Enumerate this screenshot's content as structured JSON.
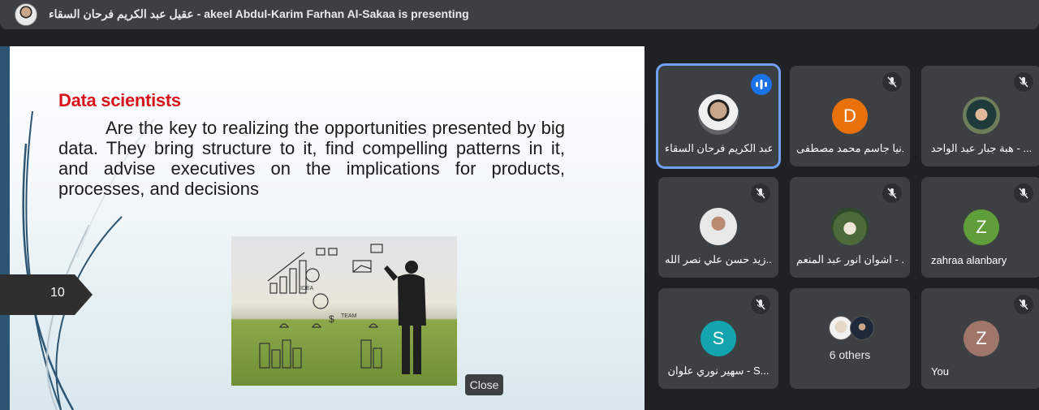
{
  "header": {
    "presenter_label": "عقيل عبد الكريم فرحان السقاء - akeel Abdul-Karim Farhan Al-Sakaa is presenting"
  },
  "slide": {
    "heading": "Data scientists",
    "body": "Are the key to realizing the opportunities presented by big data. They bring structure to it, find compelling patterns in it, and advise executives on the implications for products, processes, and decisions",
    "page_number": "10",
    "image_icon": "businessman-drawing-sketches-photo"
  },
  "controls": {
    "close_label": "Close"
  },
  "colors": {
    "heading_red": "#d7141c",
    "active_tile_border": "#6ea1f2",
    "speaking_badge": "#1a73e8"
  },
  "participants": [
    {
      "name": "عقيل عبد الكريم فرحان السقاء...",
      "avatar": "photo",
      "muted": false,
      "speaking": true
    },
    {
      "name": "دنيا جاسم محمد مصطفى...",
      "avatar": "D",
      "avatar_color": "#e8710a",
      "muted": true
    },
    {
      "name": "هبة جبار عبد الواحد - ...",
      "avatar": "photo",
      "muted": true
    },
    {
      "name": "زيد حسن علي نصر الله...",
      "avatar": "photo",
      "muted": true
    },
    {
      "name": "اشوان انور عبد المنعم - ...",
      "avatar": "photo",
      "muted": true
    },
    {
      "name": "zahraa alanbary",
      "avatar": "Z",
      "avatar_color": "#5f9e3a",
      "muted": true
    },
    {
      "name": "سهير نوري علوان - S...",
      "avatar": "S",
      "avatar_color": "#12a4af",
      "muted": true
    },
    {
      "name": "6 others",
      "avatar": "group-photos",
      "muted": false
    },
    {
      "name": "You",
      "avatar": "Z",
      "avatar_color": "#a1766a",
      "muted": true
    }
  ]
}
